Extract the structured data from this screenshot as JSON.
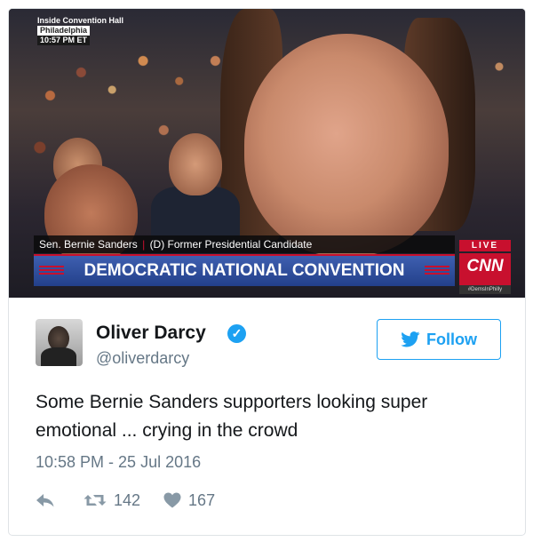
{
  "media": {
    "location_line1": "Inside Convention Hall",
    "location_line2": "Philadelphia",
    "time": "10:57 PM ET",
    "lower_third_name": "Sen. Bernie Sanders",
    "lower_third_separator": "|",
    "lower_third_role": "(D) Former Presidential Candidate",
    "banner": "DEMOCRATIC NATIONAL CONVENTION",
    "live_label": "LIVE",
    "network": "CNN",
    "network_tag": "#DemsInPhilly"
  },
  "tweet": {
    "display_name": "Oliver Darcy",
    "verified_mark": "✓",
    "handle": "@oliverdarcy",
    "follow_label": "Follow",
    "text": "Some Bernie Sanders supporters looking super emotional ... crying in the crowd",
    "timestamp": "10:58 PM - 25 Jul 2016",
    "retweet_count": "142",
    "like_count": "167"
  },
  "colors": {
    "twitter_blue": "#1da1f2",
    "cnn_red": "#c8102e",
    "banner_blue": "#2f4f9e",
    "text_primary": "#14171a",
    "text_secondary": "#657786"
  },
  "icons": [
    "verified-badge-icon",
    "twitter-bird-icon",
    "reply-icon",
    "retweet-icon",
    "heart-icon"
  ]
}
